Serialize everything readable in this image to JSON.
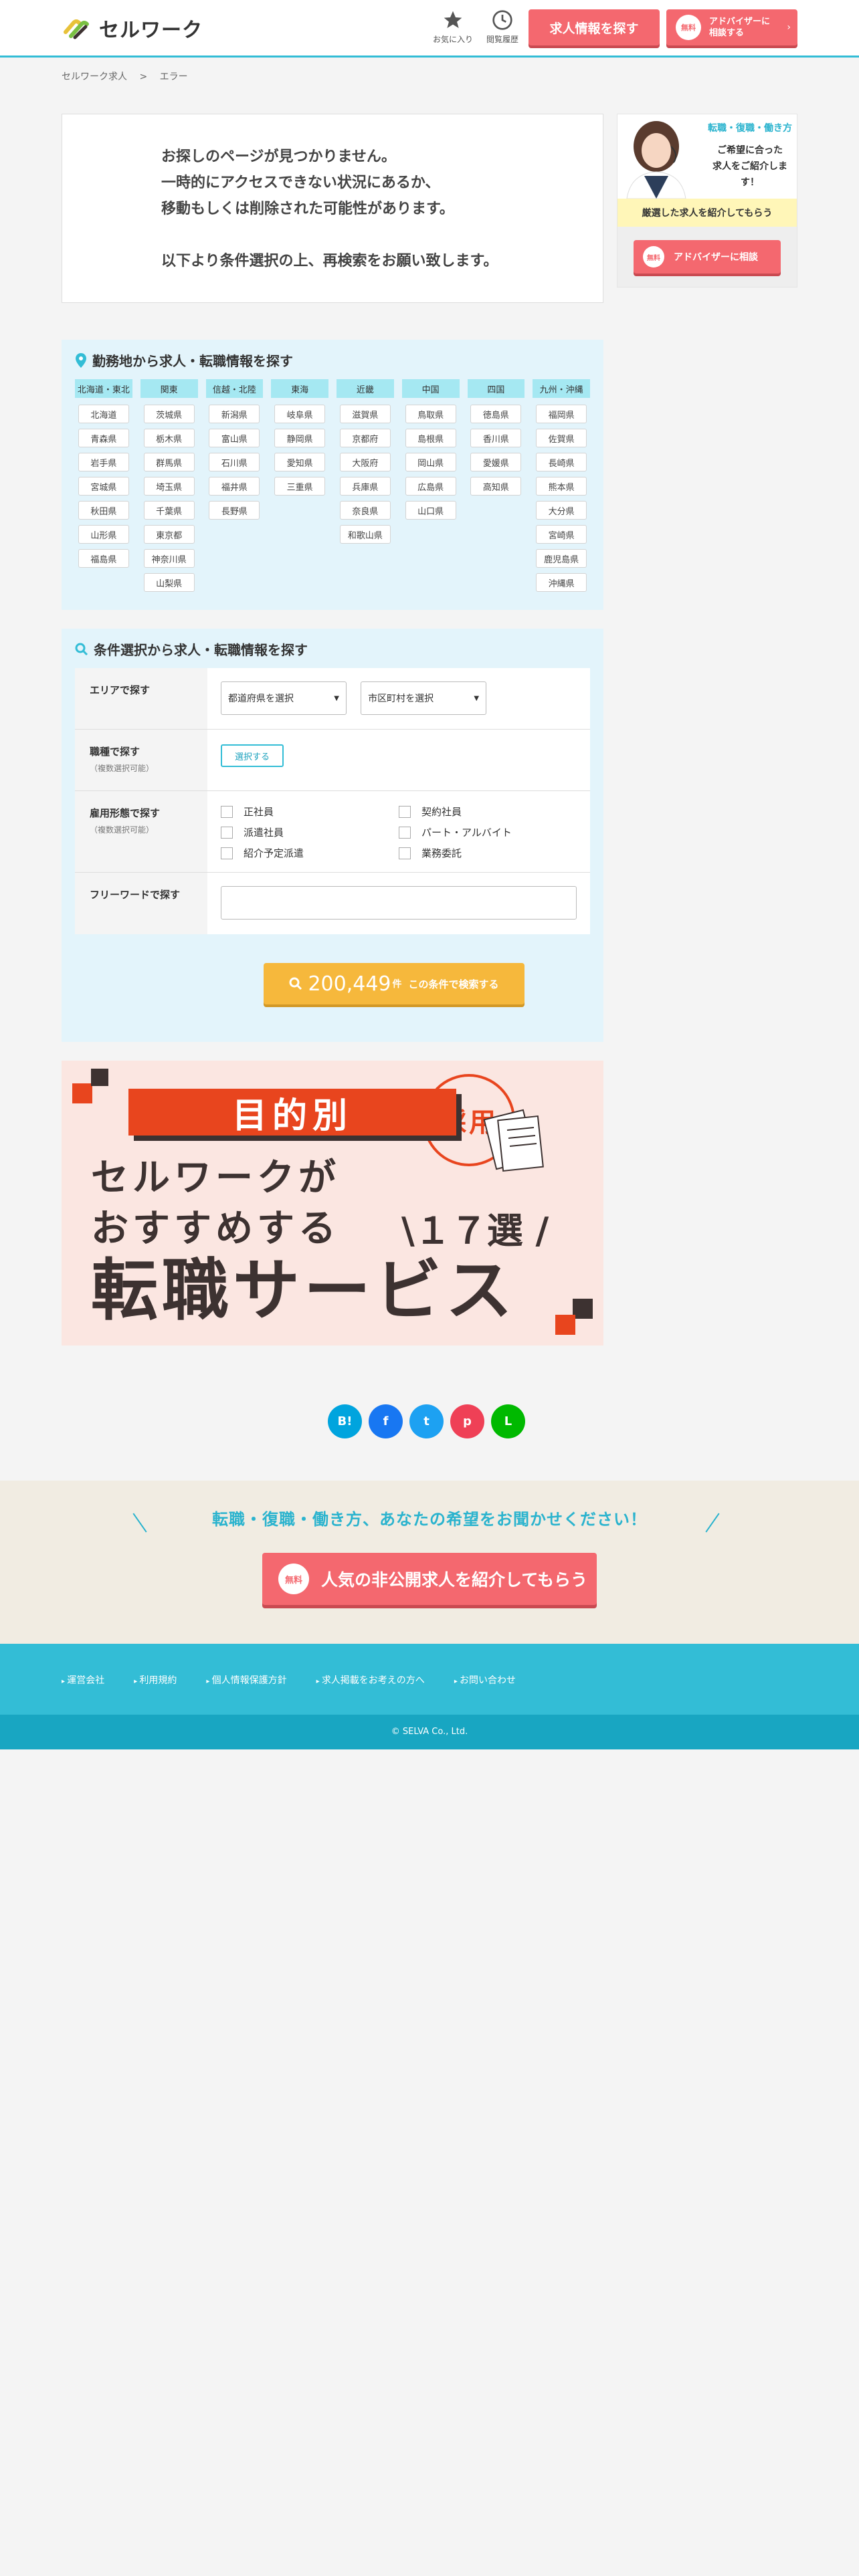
{
  "header": {
    "logo_text": "セルワーク",
    "favorites_label": "お気に入り",
    "history_label": "閲覧履歴",
    "search_jobs_label": "求人情報を探す",
    "advisor_badge": "無料",
    "advisor_line1": "アドバイザーに",
    "advisor_line2": "相談する",
    "advisor_arrow": "›"
  },
  "breadcrumb": {
    "home": "セルワーク求人",
    "sep": ">",
    "current": "エラー"
  },
  "error": {
    "line1": "お探しのページが見つかりません。",
    "line2": "一時的にアクセスできない状況にあるか、",
    "line3": "移動もしくは削除された可能性があります。",
    "line4": "以下より条件選択の上、再検索をお願い致します。"
  },
  "sidebar": {
    "title": "転職・復職・働き方",
    "line1": "ご希望に合った",
    "line2": "求人をご紹介します！",
    "yellow": "厳選した求人を紹介してもらう",
    "badge": "無料",
    "btn": "アドバイザーに相談"
  },
  "area": {
    "title": "勤務地から求人・転職情報を探す",
    "regions": [
      {
        "name": "北海道・東北",
        "prefs": [
          "北海道",
          "青森県",
          "岩手県",
          "宮城県",
          "秋田県",
          "山形県",
          "福島県"
        ]
      },
      {
        "name": "関東",
        "prefs": [
          "茨城県",
          "栃木県",
          "群馬県",
          "埼玉県",
          "千葉県",
          "東京都",
          "神奈川県",
          "山梨県"
        ]
      },
      {
        "name": "信越・北陸",
        "prefs": [
          "新潟県",
          "富山県",
          "石川県",
          "福井県",
          "長野県"
        ]
      },
      {
        "name": "東海",
        "prefs": [
          "岐阜県",
          "静岡県",
          "愛知県",
          "三重県"
        ]
      },
      {
        "name": "近畿",
        "prefs": [
          "滋賀県",
          "京都府",
          "大阪府",
          "兵庫県",
          "奈良県",
          "和歌山県"
        ]
      },
      {
        "name": "中国",
        "prefs": [
          "鳥取県",
          "島根県",
          "岡山県",
          "広島県",
          "山口県"
        ]
      },
      {
        "name": "四国",
        "prefs": [
          "徳島県",
          "香川県",
          "愛媛県",
          "高知県"
        ]
      },
      {
        "name": "九州・沖縄",
        "prefs": [
          "福岡県",
          "佐賀県",
          "長崎県",
          "熊本県",
          "大分県",
          "宮崎県",
          "鹿児島県",
          "沖縄県"
        ]
      }
    ]
  },
  "conditions": {
    "title": "条件選択から求人・転職情報を探す",
    "area_label": "エリアで探す",
    "pref_select": "都道府県を選択",
    "city_select": "市区町村を選択",
    "job_label": "職種で探す",
    "job_sub": "（複数選択可能）",
    "choose_btn": "選択する",
    "emp_label": "雇用形態で探す",
    "emp_sub": "（複数選択可能）",
    "emp_types": [
      "正社員",
      "契約社員",
      "派遣社員",
      "パート・アルバイト",
      "紹介予定派遣",
      "業務委託"
    ],
    "free_label": "フリーワードで探す",
    "free_placeholder": "",
    "count": "200,449",
    "count_unit": "件",
    "search_label": "この条件で検索する"
  },
  "banner": {
    "tag": "目的別",
    "line1": "セルワークが",
    "line2": "おすすめする",
    "num": "\\１７選 /",
    "line3": "転職サービス",
    "stamp": "採用"
  },
  "social": [
    {
      "name": "hatena",
      "label": "B!",
      "color": "#00a4de"
    },
    {
      "name": "facebook",
      "label": "f",
      "color": "#1877f2"
    },
    {
      "name": "twitter",
      "label": "t",
      "color": "#1da1f2"
    },
    {
      "name": "pocket",
      "label": "p",
      "color": "#ef4056"
    },
    {
      "name": "line",
      "label": "L",
      "color": "#00b900"
    }
  ],
  "hope": {
    "title": "転職・復職・働き方、あなたの希望をお聞かせください！",
    "badge": "無料",
    "btn": "人気の非公開求人を紹介してもらう"
  },
  "footer": {
    "links": [
      "運営会社",
      "利用規約",
      "個人情報保護方針",
      "求人掲載をお考えの方へ",
      "お問い合わせ"
    ],
    "copyright": "© SELVA Co., Ltd."
  },
  "colors": {
    "accent": "#33bdd6",
    "cta": "#f4686f",
    "search": "#f6b83c",
    "banner_red": "#e8451e"
  }
}
